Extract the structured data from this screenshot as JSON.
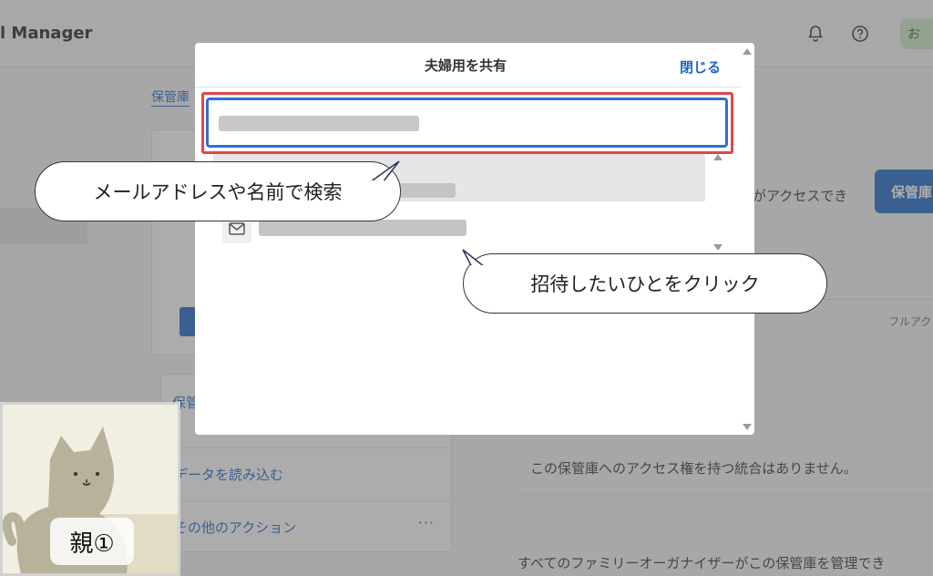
{
  "app": {
    "title": "l Manager"
  },
  "topbar": {
    "avatar_initial": "お"
  },
  "breadcrumb": {
    "link": "保管庫"
  },
  "background": {
    "access_text": "がアクセスでき",
    "primary_button": "保管庫",
    "column_header": "フルアク",
    "no_integrations": "この保管庫へのアクセス権を持つ統合はありません。",
    "family_organizer_text": "すべてのファミリーオーガナイザーがこの保管庫を管理でき",
    "section_title": "保管",
    "rows": [
      {
        "label": "データを読み込む"
      },
      {
        "label": "その他のアクション"
      }
    ],
    "more_dots": "···"
  },
  "dialog": {
    "title": "夫婦用を共有",
    "close_label": "閉じる",
    "search": {
      "placeholder": "",
      "value": ""
    }
  },
  "callouts": {
    "search": "メールアドレスや名前で検索",
    "click": "招待したいひとをクリック"
  },
  "presenter": {
    "label": "親①"
  }
}
